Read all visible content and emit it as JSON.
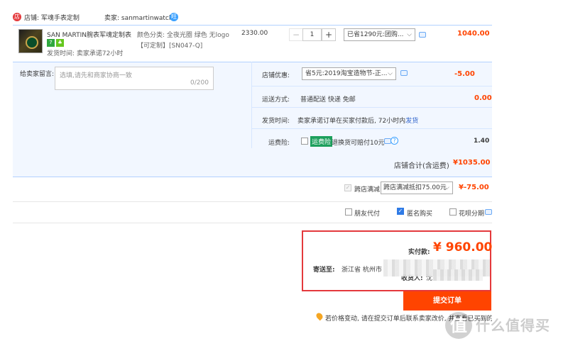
{
  "store": {
    "logo_glyph": "店",
    "label": "店铺: 军魂手表定制",
    "seller": "卖家: sanmartinwatch",
    "ww_glyph": "旺"
  },
  "item": {
    "title": "SAN MARTIN腕表军魂定制表...",
    "badge1": "7",
    "badge2": "♣",
    "ship_promise": "发货时间: 卖家承诺72小时",
    "sku_attr": "颜色分类: 全夜光圈 绿色 无logo",
    "sku_custom": "【可定制】[SN047-Q]",
    "price": "2330.00",
    "qty_minus": "−",
    "qty": "1",
    "qty_plus": "+",
    "promo": "已省1290元:团购...",
    "total": "1040.00"
  },
  "message": {
    "label": "给卖家留言:",
    "placeholder": "选填,请先和商家协商一致",
    "count": "0/200"
  },
  "coupon": {
    "label": "店铺优惠:",
    "selected": "省5元:2019淘宝造物节-正...",
    "value": "-5.00"
  },
  "shipping": {
    "label": "运送方式:",
    "method": "普通配送 快递 免邮",
    "fee": "0.00"
  },
  "delivery_time": {
    "label": "发货时间:",
    "text": "卖家承诺订单在买家付款后, 72小时内",
    "link": "发货"
  },
  "insurance": {
    "label": "运费险:",
    "tag": "运费险",
    "text": "退换货可赔付10元",
    "help": "?",
    "fee": "1.40"
  },
  "store_total": {
    "label": "店铺合计(含运费)",
    "value": "¥1035.00"
  },
  "cross_store": {
    "check_glyph": "✓",
    "label": "跨店满减",
    "selected": "跨店满减抵扣75.00元",
    "value": "¥-75.00"
  },
  "options": {
    "friend_pay": "朋友代付",
    "anonymous": "匿名购买",
    "anonymous_check": "✓",
    "huabei": "花呗分期"
  },
  "summary": {
    "pay_label": "实付款:",
    "pay_value": "¥ 960.00",
    "address_label": "寄送至:",
    "address_text": "浙江省 杭州市",
    "receiver_label": "收货人:",
    "receiver_name": "沈"
  },
  "submit": {
    "label": "提交订单"
  },
  "notice": {
    "text": "若价格变动, 请在提交订单后联系卖家改价, 并查看已买到的宝贝"
  },
  "watermark": {
    "logo": "值",
    "text": "什么值得买"
  },
  "chevron": "⌵"
}
